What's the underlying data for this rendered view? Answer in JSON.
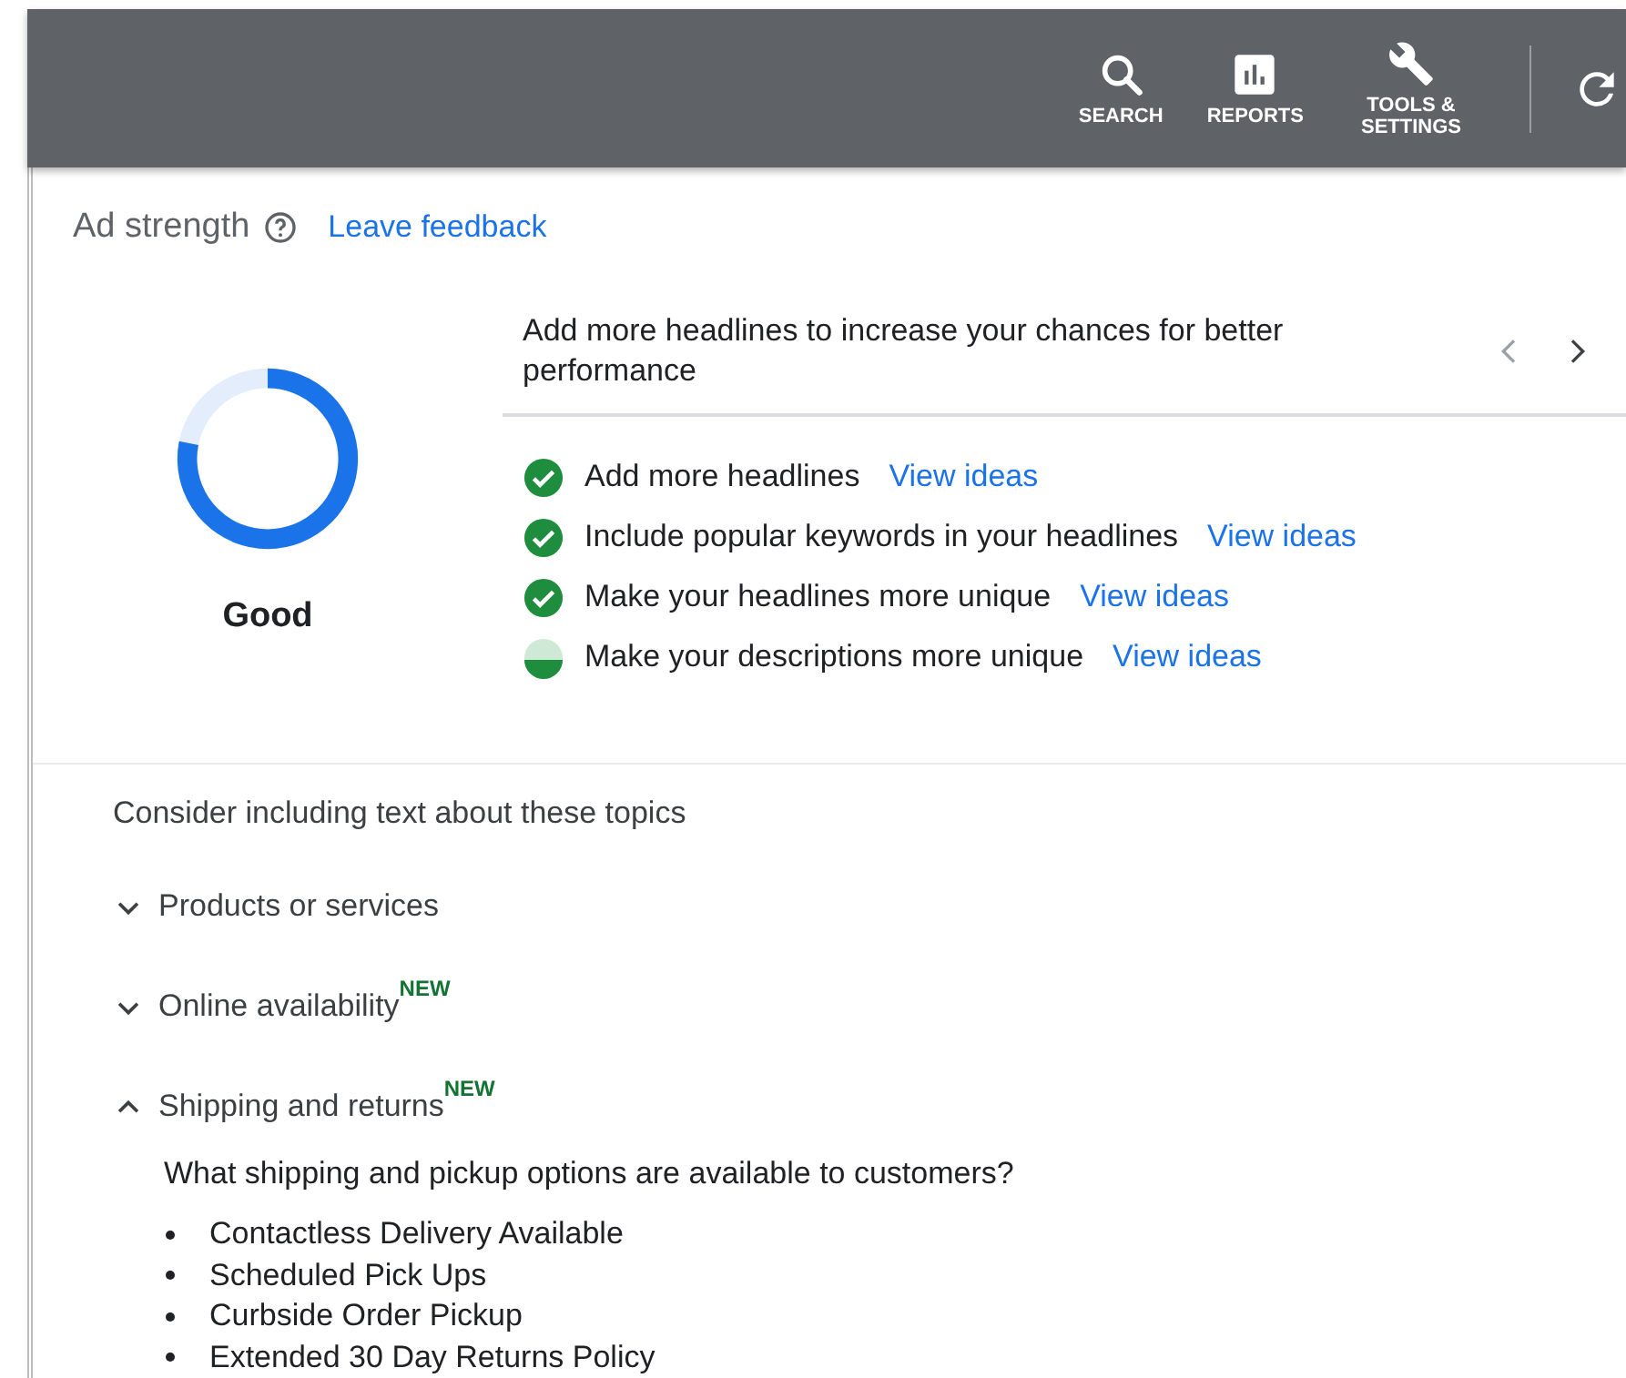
{
  "toolbar": {
    "items": [
      {
        "kind": "search",
        "label": "SEARCH"
      },
      {
        "kind": "reports",
        "label": "REPORTS"
      },
      {
        "kind": "tools",
        "label": "TOOLS & SETTINGS"
      }
    ]
  },
  "ad_strength": {
    "title": "Ad strength",
    "feedback_link": "Leave feedback",
    "level": 0.78,
    "rating": "Good",
    "message": "Add more headlines to increase your chances for better performance",
    "checklist": [
      {
        "text": "Add more headlines",
        "link": "View ideas",
        "kind": "done"
      },
      {
        "text": "Include popular keywords in your headlines",
        "link": "View ideas",
        "kind": "done"
      },
      {
        "text": "Make your headlines more unique",
        "link": "View ideas",
        "kind": "done"
      },
      {
        "text": "Make your descriptions more unique",
        "link": "View ideas",
        "kind": "partial"
      }
    ]
  },
  "topics": {
    "intro": "Consider including text about these topics",
    "items": [
      {
        "label": "Products or services",
        "expanded": false
      },
      {
        "label": "Online availability",
        "badge": "NEW",
        "expanded": false
      },
      {
        "label": "Shipping and returns",
        "badge": "NEW",
        "expanded": true,
        "question": "What shipping and pickup options are available to customers?",
        "bullets": [
          "Contactless Delivery Available",
          "Scheduled Pick Ups",
          "Curbside Order Pickup",
          "Extended 30 Day Returns Policy"
        ]
      }
    ]
  }
}
